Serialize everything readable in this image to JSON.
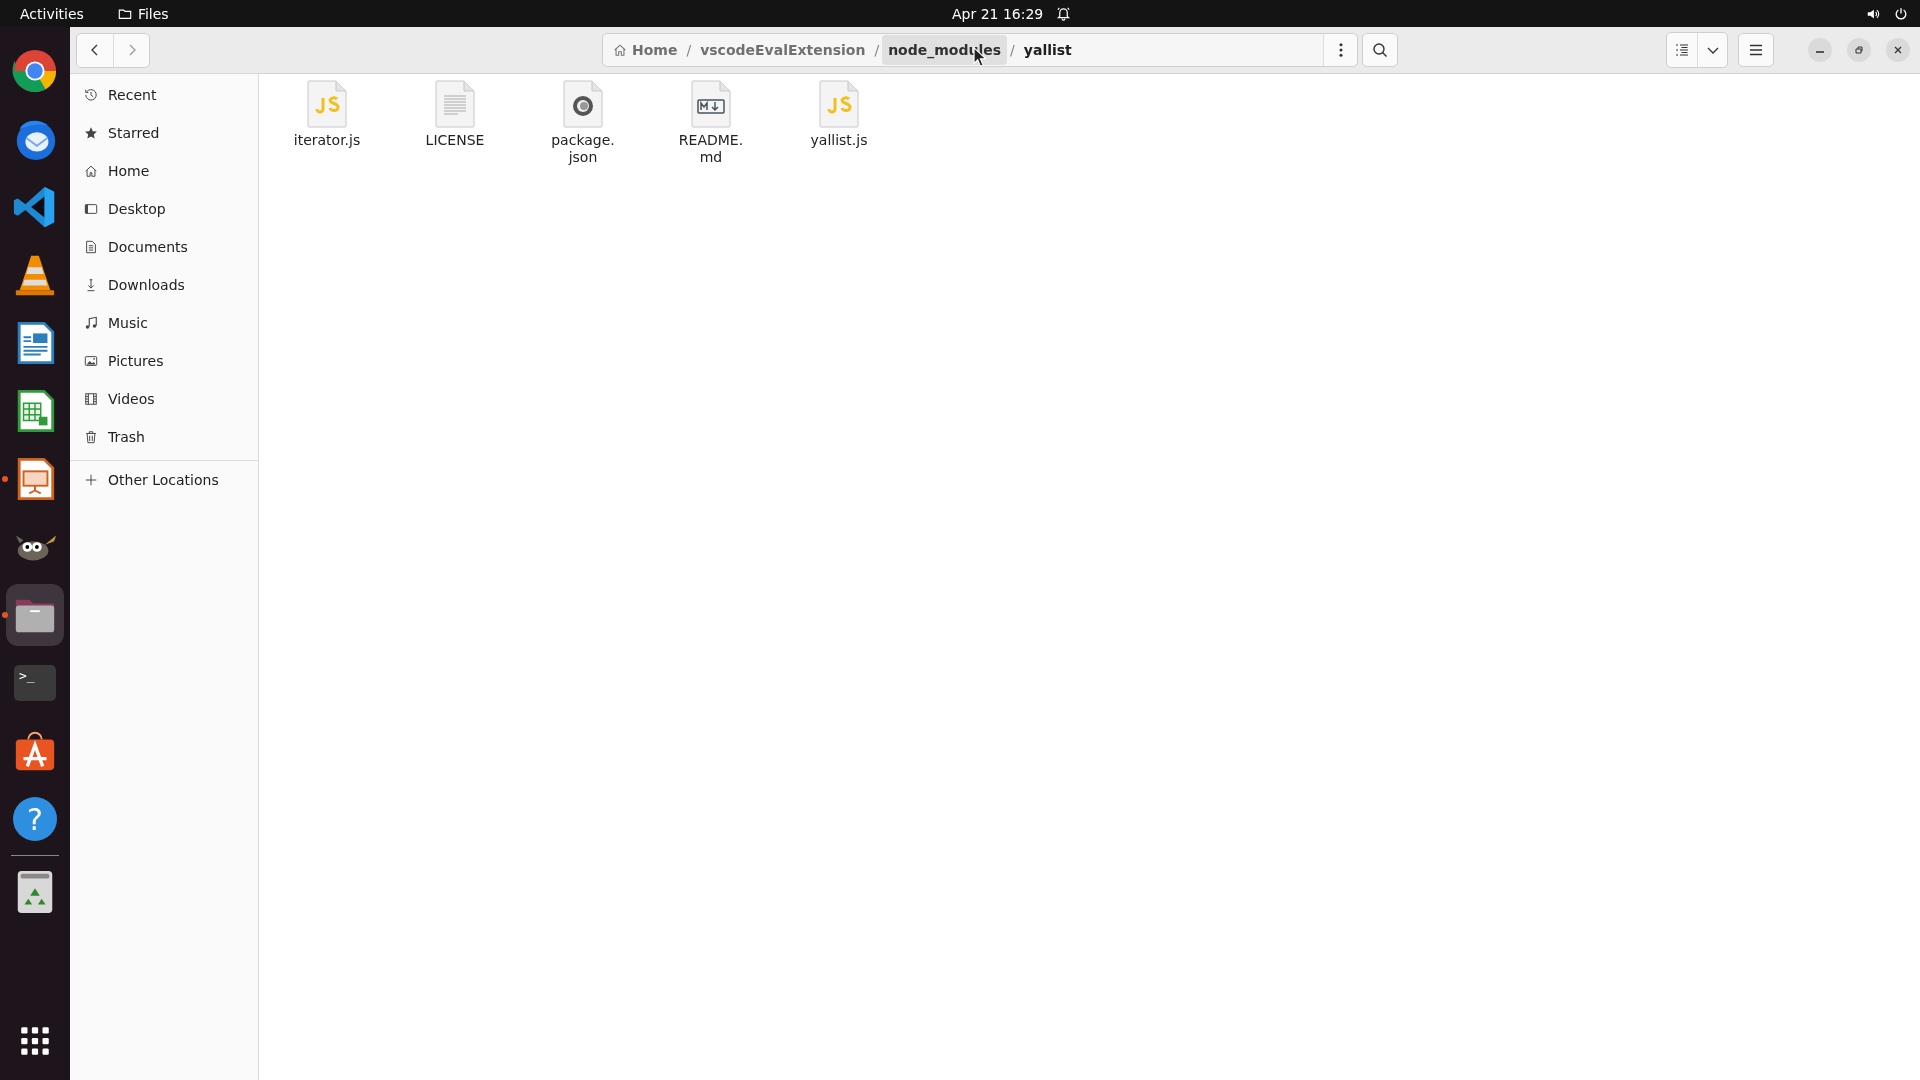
{
  "top_bar": {
    "activities": "Activities",
    "app_name": "Files",
    "clock": "Apr 21  16:29"
  },
  "dock": [
    {
      "kind": "chrome",
      "running": false,
      "selected": false
    },
    {
      "kind": "mail",
      "running": false,
      "selected": false
    },
    {
      "kind": "code",
      "running": false,
      "selected": false
    },
    {
      "kind": "cone",
      "running": false,
      "selected": false
    },
    {
      "kind": "writer",
      "running": false,
      "selected": false
    },
    {
      "kind": "calc",
      "running": false,
      "selected": false
    },
    {
      "kind": "impress",
      "running": true,
      "selected": false
    },
    {
      "kind": "gimp",
      "running": false,
      "selected": false
    },
    {
      "kind": "files",
      "running": true,
      "selected": true
    },
    {
      "kind": "terminal",
      "glyph": ">_",
      "running": false,
      "selected": false
    },
    {
      "kind": "store",
      "running": false,
      "selected": false
    },
    {
      "kind": "help",
      "glyph": "?",
      "running": false,
      "selected": false
    },
    {
      "kind": "trash",
      "running": false,
      "selected": false
    }
  ],
  "breadcrumb": [
    {
      "label": "Home",
      "kind": "home",
      "hovered": false,
      "current": false
    },
    {
      "separator": "/",
      "label": "vscodeEvalExtension",
      "kind": "folder",
      "hovered": false,
      "current": false
    },
    {
      "separator": "/",
      "label": "node_modules",
      "kind": "folder",
      "hovered": true,
      "current": false
    },
    {
      "separator": "/",
      "label": "yallist",
      "kind": "folder",
      "hovered": false,
      "current": true
    }
  ],
  "sidebar": {
    "items": [
      {
        "label": "Recent",
        "kind": "recent"
      },
      {
        "label": "Starred",
        "kind": "starred"
      },
      {
        "label": "Home",
        "kind": "home"
      },
      {
        "label": "Desktop",
        "kind": "desktop"
      },
      {
        "label": "Documents",
        "kind": "documents"
      },
      {
        "label": "Downloads",
        "kind": "downloads"
      },
      {
        "label": "Music",
        "kind": "music"
      },
      {
        "label": "Pictures",
        "kind": "pictures"
      },
      {
        "label": "Videos",
        "kind": "videos"
      },
      {
        "label": "Trash",
        "kind": "trash"
      }
    ],
    "other": {
      "label": "Other Locations"
    }
  },
  "files": [
    {
      "name": "iterator.js",
      "kind": "js"
    },
    {
      "name": "LICENSE",
      "kind": "text"
    },
    {
      "name": "package.\njson",
      "kind": "json"
    },
    {
      "name": "README.\nmd",
      "kind": "markdown"
    },
    {
      "name": "yallist.js",
      "kind": "js"
    }
  ]
}
